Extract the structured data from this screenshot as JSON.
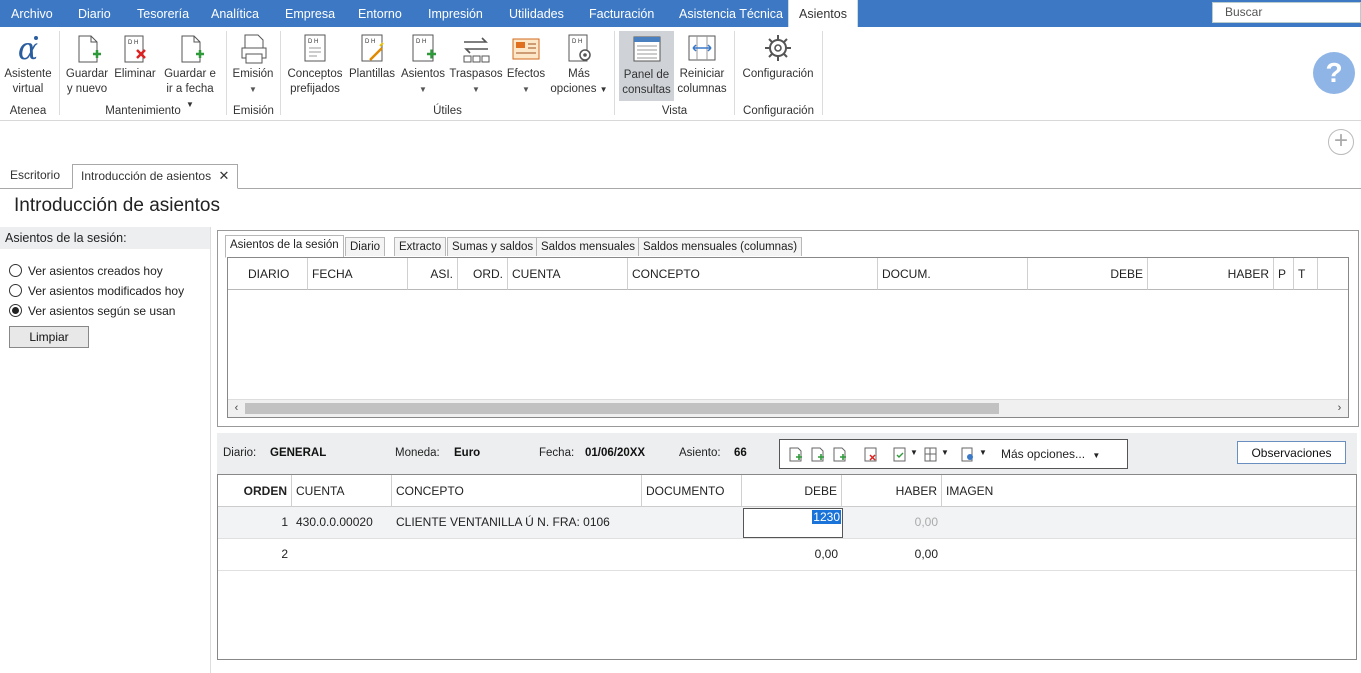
{
  "menu": {
    "items": [
      "Archivo",
      "Diario",
      "Tesorería",
      "Analítica",
      "Empresa",
      "Entorno",
      "Impresión",
      "Utilidades",
      "Facturación",
      "Asistencia Técnica",
      "Asientos"
    ],
    "search_placeholder": "Buscar"
  },
  "ribbon": {
    "asistente": [
      "Asistente",
      "virtual"
    ],
    "guardar": [
      "Guardar",
      "y nuevo"
    ],
    "eliminar": "Eliminar",
    "guardar_fecha": [
      "Guardar e",
      "ir a fecha"
    ],
    "emision": "Emisión",
    "conceptos": [
      "Conceptos",
      "prefijados"
    ],
    "plantillas": "Plantillas",
    "asientos": "Asientos",
    "traspasos": "Traspasos",
    "efectos": "Efectos",
    "mas": [
      "Más",
      "opciones"
    ],
    "panel": [
      "Panel de",
      "consultas"
    ],
    "reiniciar": [
      "Reiniciar",
      "columnas"
    ],
    "configuracion": "Configuración",
    "groups": [
      "Atenea",
      "Mantenimiento",
      "Emisión",
      "Útiles",
      "Vista",
      "Configuración"
    ]
  },
  "doc_tabs": [
    "Escritorio",
    "Introducción de asientos"
  ],
  "page_title": "Introducción de asientos",
  "left": {
    "header": "Asientos de la sesión:",
    "options": [
      "Ver asientos creados hoy",
      "Ver asientos modificados hoy",
      "Ver asientos según se usan"
    ],
    "selected_index": 2,
    "clear_button": "Limpiar"
  },
  "upper": {
    "tabs": [
      "Asientos de la sesión",
      "Diario",
      "Extracto",
      "Sumas y saldos",
      "Saldos mensuales",
      "Saldos mensuales (columnas)"
    ],
    "columns": [
      "DIARIO",
      "FECHA",
      "ASI.",
      "ORD.",
      "CUENTA",
      "CONCEPTO",
      "DOCUM.",
      "DEBE",
      "HABER",
      "P",
      "T"
    ]
  },
  "info": {
    "diario_label": "Diario:",
    "diario_value": "GENERAL",
    "moneda_label": "Moneda:",
    "moneda_value": "Euro",
    "fecha_label": "Fecha:",
    "fecha_value": "01/06/20XX",
    "asiento_label": "Asiento:",
    "asiento_value": "66",
    "more_options": "Más opciones...",
    "observaciones": "Observaciones"
  },
  "entries": {
    "columns": [
      "ORDEN",
      "CUENTA",
      "CONCEPTO",
      "DOCUMENTO",
      "DEBE",
      "HABER",
      "IMAGEN"
    ],
    "rows": [
      {
        "orden": "1",
        "cuenta": "430.0.0.00020",
        "concepto": "CLIENTE VENTANILLA Ú N. FRA:  0106",
        "documento": "",
        "debe": "1230",
        "haber": "0,00"
      },
      {
        "orden": "2",
        "cuenta": "",
        "concepto": "",
        "documento": "",
        "debe": "0,00",
        "haber": "0,00"
      }
    ]
  }
}
